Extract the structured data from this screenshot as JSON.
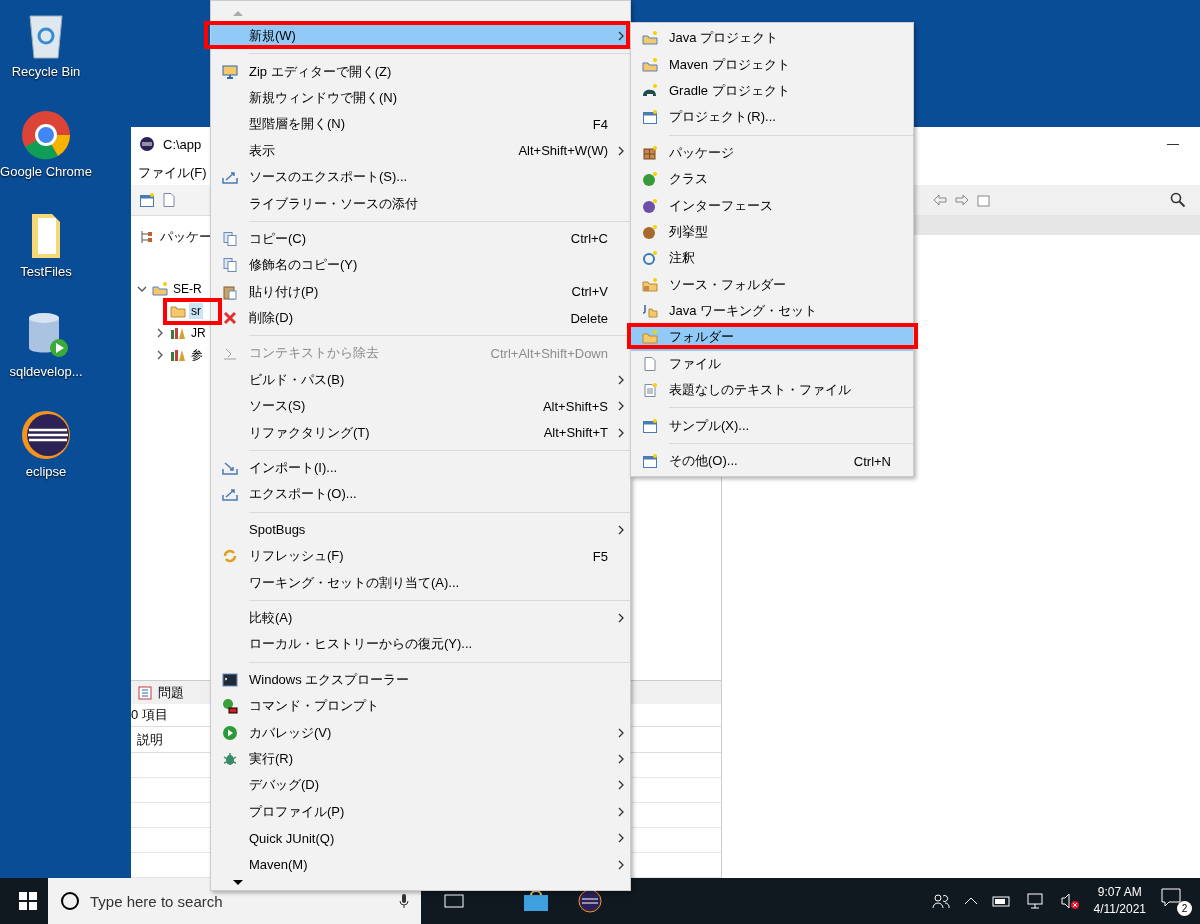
{
  "desktop_icons": [
    {
      "label": "Recycle Bin"
    },
    {
      "label": "Google Chrome"
    },
    {
      "label": "TestFiles"
    },
    {
      "label": "sqldevelop..."
    },
    {
      "label": "eclipse"
    }
  ],
  "eclipse_window": {
    "title": "C:\\app",
    "menu": [
      "ファイル(F)"
    ],
    "package_explorer": {
      "tab": "パッケー",
      "tree": [
        {
          "label": "SE-R",
          "expanded": true,
          "selected": false,
          "children": [
            {
              "label": "sr",
              "selected": true
            },
            {
              "label": "JR",
              "expanded": false,
              "selected": false
            },
            {
              "label": "参",
              "expanded": false,
              "selected": false
            }
          ]
        }
      ]
    },
    "problems_view": {
      "tab": "問題",
      "count": "0 項目",
      "columns": [
        "説明"
      ]
    }
  },
  "context_menu": {
    "items": [
      {
        "kind": "item",
        "label": "新規(W)",
        "submenu": true,
        "selected": true,
        "disabled": false
      },
      {
        "kind": "separator"
      },
      {
        "kind": "item",
        "label": "Zip エディターで開く(Z)",
        "submenu": false,
        "selected": false,
        "disabled": false
      },
      {
        "kind": "item",
        "label": "新規ウィンドウで開く(N)",
        "submenu": false,
        "selected": false,
        "disabled": false
      },
      {
        "kind": "item",
        "label": "型階層を開く(N)",
        "shortcut": "F4",
        "submenu": false,
        "selected": false,
        "disabled": false
      },
      {
        "kind": "item",
        "label": "表示",
        "shortcut": "Alt+Shift+W(W)",
        "submenu": true,
        "selected": false,
        "disabled": false
      },
      {
        "kind": "item",
        "label": "ソースのエクスポート(S)...",
        "submenu": false,
        "selected": false,
        "disabled": false
      },
      {
        "kind": "item",
        "label": "ライブラリー・ソースの添付",
        "submenu": false,
        "selected": false,
        "disabled": false
      },
      {
        "kind": "separator"
      },
      {
        "kind": "item",
        "label": "コピー(C)",
        "shortcut": "Ctrl+C",
        "submenu": false,
        "selected": false,
        "disabled": false
      },
      {
        "kind": "item",
        "label": "修飾名のコピー(Y)",
        "submenu": false,
        "selected": false,
        "disabled": false
      },
      {
        "kind": "item",
        "label": "貼り付け(P)",
        "shortcut": "Ctrl+V",
        "submenu": false,
        "selected": false,
        "disabled": false
      },
      {
        "kind": "item",
        "label": "削除(D)",
        "shortcut": "Delete",
        "submenu": false,
        "selected": false,
        "disabled": false
      },
      {
        "kind": "separator"
      },
      {
        "kind": "item",
        "label": "コンテキストから除去",
        "shortcut": "Ctrl+Alt+Shift+Down",
        "submenu": false,
        "selected": false,
        "disabled": true
      },
      {
        "kind": "item",
        "label": "ビルド・パス(B)",
        "submenu": true,
        "selected": false,
        "disabled": false
      },
      {
        "kind": "item",
        "label": "ソース(S)",
        "shortcut": "Alt+Shift+S",
        "submenu": true,
        "selected": false,
        "disabled": false
      },
      {
        "kind": "item",
        "label": "リファクタリング(T)",
        "shortcut": "Alt+Shift+T",
        "submenu": true,
        "selected": false,
        "disabled": false
      },
      {
        "kind": "separator"
      },
      {
        "kind": "item",
        "label": "インポート(I)...",
        "submenu": false,
        "selected": false,
        "disabled": false
      },
      {
        "kind": "item",
        "label": "エクスポート(O)...",
        "submenu": false,
        "selected": false,
        "disabled": false
      },
      {
        "kind": "separator"
      },
      {
        "kind": "item",
        "label": "SpotBugs",
        "submenu": true,
        "selected": false,
        "disabled": false
      },
      {
        "kind": "item",
        "label": "リフレッシュ(F)",
        "shortcut": "F5",
        "submenu": false,
        "selected": false,
        "disabled": false
      },
      {
        "kind": "item",
        "label": "ワーキング・セットの割り当て(A)...",
        "submenu": false,
        "selected": false,
        "disabled": false
      },
      {
        "kind": "separator"
      },
      {
        "kind": "item",
        "label": "比較(A)",
        "submenu": true,
        "selected": false,
        "disabled": false
      },
      {
        "kind": "item",
        "label": "ローカル・ヒストリーからの復元(Y)...",
        "submenu": false,
        "selected": false,
        "disabled": false
      },
      {
        "kind": "separator"
      },
      {
        "kind": "item",
        "label": "Windows エクスプローラー",
        "submenu": false,
        "selected": false,
        "disabled": false
      },
      {
        "kind": "item",
        "label": "コマンド・プロンプト",
        "submenu": false,
        "selected": false,
        "disabled": false
      },
      {
        "kind": "item",
        "label": "カバレッジ(V)",
        "submenu": true,
        "selected": false,
        "disabled": false
      },
      {
        "kind": "item",
        "label": "実行(R)",
        "submenu": true,
        "selected": false,
        "disabled": false
      },
      {
        "kind": "item",
        "label": "デバッグ(D)",
        "submenu": true,
        "selected": false,
        "disabled": false
      },
      {
        "kind": "item",
        "label": "プロファイル(P)",
        "submenu": true,
        "selected": false,
        "disabled": false
      },
      {
        "kind": "item",
        "label": "Quick JUnit(Q)",
        "submenu": true,
        "selected": false,
        "disabled": false
      },
      {
        "kind": "item",
        "label": "Maven(M)",
        "submenu": true,
        "selected": false,
        "disabled": false
      }
    ]
  },
  "new_submenu": {
    "items": [
      {
        "kind": "item",
        "label": "Java プロジェクト",
        "selected": false
      },
      {
        "kind": "item",
        "label": "Maven プロジェクト",
        "selected": false
      },
      {
        "kind": "item",
        "label": "Gradle プロジェクト",
        "selected": false
      },
      {
        "kind": "item",
        "label": "プロジェクト(R)...",
        "selected": false
      },
      {
        "kind": "separator"
      },
      {
        "kind": "item",
        "label": "パッケージ",
        "selected": false
      },
      {
        "kind": "item",
        "label": "クラス",
        "selected": false
      },
      {
        "kind": "item",
        "label": "インターフェース",
        "selected": false
      },
      {
        "kind": "item",
        "label": "列挙型",
        "selected": false
      },
      {
        "kind": "item",
        "label": "注釈",
        "selected": false
      },
      {
        "kind": "item",
        "label": "ソース・フォルダー",
        "selected": false
      },
      {
        "kind": "item",
        "label": "Java ワーキング・セット",
        "selected": false
      },
      {
        "kind": "item",
        "label": "フォルダー",
        "selected": true
      },
      {
        "kind": "item",
        "label": "ファイル",
        "selected": false
      },
      {
        "kind": "item",
        "label": "表題なしのテキスト・ファイル",
        "selected": false
      },
      {
        "kind": "separator"
      },
      {
        "kind": "item",
        "label": "サンプル(X)...",
        "selected": false
      },
      {
        "kind": "separator"
      },
      {
        "kind": "item",
        "label": "その他(O)...",
        "shortcut": "Ctrl+N",
        "selected": false
      }
    ]
  },
  "taskbar": {
    "search": {
      "placeholder": "Type here to search"
    },
    "time": "9:07 AM",
    "date": "4/11/2021",
    "notifications": "2"
  }
}
